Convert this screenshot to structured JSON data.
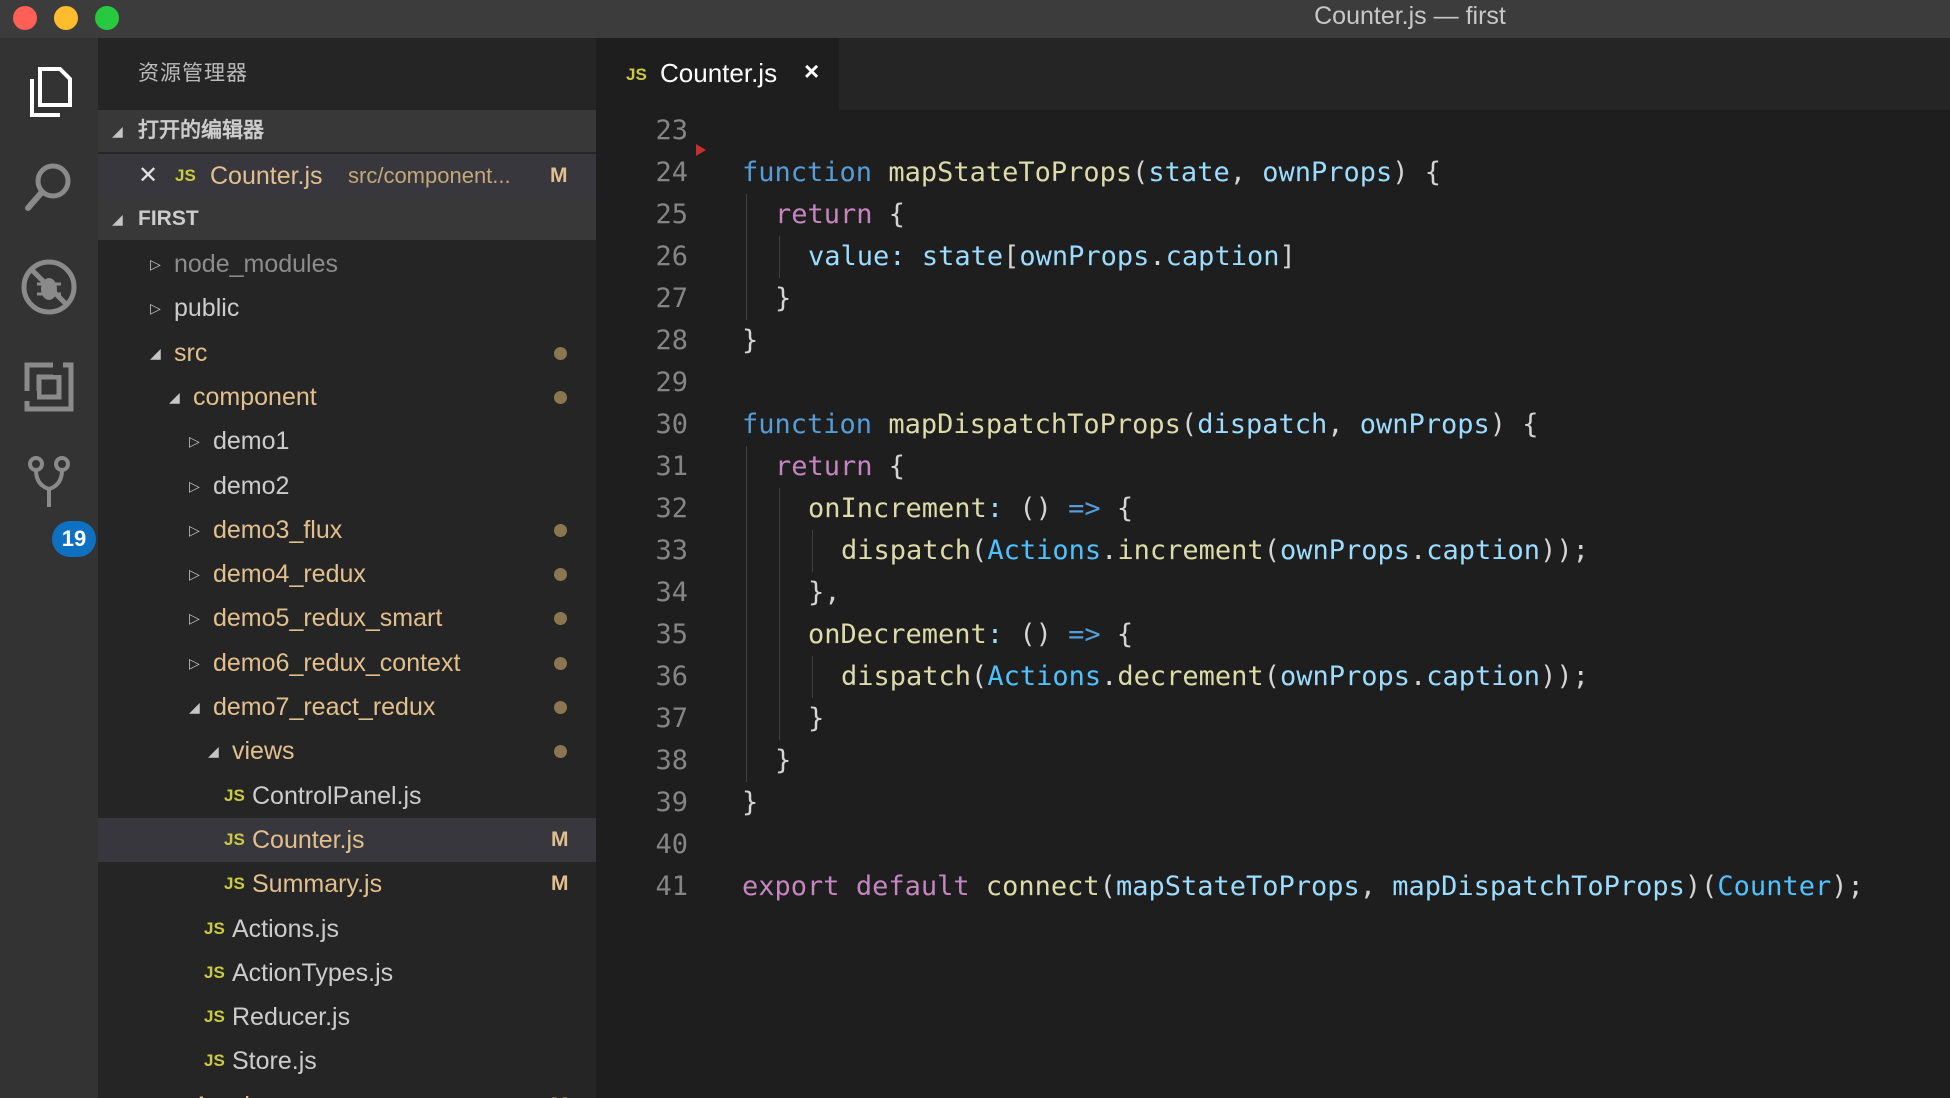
{
  "window": {
    "title": "Counter.js — first"
  },
  "activity_bar": {
    "items": [
      {
        "name": "explorer-icon"
      },
      {
        "name": "search-icon"
      },
      {
        "name": "debug-icon"
      },
      {
        "name": "extensions-icon"
      },
      {
        "name": "source-control-icon"
      }
    ],
    "scm_badge": "19"
  },
  "sidebar": {
    "title": "资源管理器",
    "open_editors": {
      "header": "打开的编辑器",
      "items": [
        {
          "icon": "JS",
          "name": "Counter.js",
          "path": "src/component...",
          "status": "M"
        }
      ]
    },
    "folder": {
      "header": "FIRST",
      "rows": [
        {
          "label": "node_modules",
          "type": "folder",
          "expanded": false,
          "depth": 1,
          "style": "ignored"
        },
        {
          "label": "public",
          "type": "folder",
          "expanded": false,
          "depth": 1,
          "style": "normal"
        },
        {
          "label": "src",
          "type": "folder",
          "expanded": true,
          "depth": 1,
          "style": "modified",
          "dot": true
        },
        {
          "label": "component",
          "type": "folder",
          "expanded": true,
          "depth": 2,
          "style": "modified",
          "dot": true
        },
        {
          "label": "demo1",
          "type": "folder",
          "expanded": false,
          "depth": 3,
          "style": "normal"
        },
        {
          "label": "demo2",
          "type": "folder",
          "expanded": false,
          "depth": 3,
          "style": "normal"
        },
        {
          "label": "demo3_flux",
          "type": "folder",
          "expanded": false,
          "depth": 3,
          "style": "modified",
          "dot": true
        },
        {
          "label": "demo4_redux",
          "type": "folder",
          "expanded": false,
          "depth": 3,
          "style": "modified",
          "dot": true
        },
        {
          "label": "demo5_redux_smart",
          "type": "folder",
          "expanded": false,
          "depth": 3,
          "style": "modified",
          "dot": true
        },
        {
          "label": "demo6_redux_context",
          "type": "folder",
          "expanded": false,
          "depth": 3,
          "style": "modified",
          "dot": true
        },
        {
          "label": "demo7_react_redux",
          "type": "folder",
          "expanded": true,
          "depth": 3,
          "style": "modified",
          "dot": true
        },
        {
          "label": "views",
          "type": "folder",
          "expanded": true,
          "depth": 4,
          "style": "modified",
          "dot": true
        },
        {
          "label": "ControlPanel.js",
          "type": "file",
          "depth": 5,
          "style": "normal",
          "icon": "JS"
        },
        {
          "label": "Counter.js",
          "type": "file",
          "depth": 5,
          "style": "modified",
          "icon": "JS",
          "status": "M",
          "selected": true
        },
        {
          "label": "Summary.js",
          "type": "file",
          "depth": 5,
          "style": "modified",
          "icon": "JS",
          "status": "M"
        },
        {
          "label": "Actions.js",
          "type": "file",
          "depth": 4,
          "style": "normal",
          "icon": "JS"
        },
        {
          "label": "ActionTypes.js",
          "type": "file",
          "depth": 4,
          "style": "normal",
          "icon": "JS"
        },
        {
          "label": "Reducer.js",
          "type": "file",
          "depth": 4,
          "style": "normal",
          "icon": "JS"
        },
        {
          "label": "Store.js",
          "type": "file",
          "depth": 4,
          "style": "normal",
          "icon": "JS"
        },
        {
          "label": "App.js",
          "type": "file",
          "depth": 2,
          "style": "modified",
          "icon": "JS",
          "status": "M"
        }
      ]
    }
  },
  "editor": {
    "tab": {
      "icon": "JS",
      "name": "Counter.js",
      "close": "×"
    },
    "lines": [
      {
        "n": "23",
        "indent": 0,
        "tokens": []
      },
      {
        "n": "24",
        "indent": 0,
        "tokens": [
          [
            "kw",
            "function"
          ],
          [
            "",
            " "
          ],
          [
            "fn",
            "mapStateToProps"
          ],
          [
            "",
            "("
          ],
          [
            "param",
            "state"
          ],
          [
            "",
            ", "
          ],
          [
            "param",
            "ownProps"
          ],
          [
            "",
            ") {"
          ]
        ]
      },
      {
        "n": "25",
        "indent": 1,
        "tokens": [
          [
            "ctl",
            "return"
          ],
          [
            "",
            ""
          ],
          [
            "",
            ""
          ],
          [
            "",
            " {"
          ]
        ]
      },
      {
        "n": "26",
        "indent": 2,
        "tokens": [
          [
            "prop",
            "value"
          ],
          [
            "prop",
            ":"
          ],
          [
            "",
            " "
          ],
          [
            "param",
            "state"
          ],
          [
            "",
            "["
          ],
          [
            "param",
            "ownProps"
          ],
          [
            "",
            "."
          ],
          [
            "prop",
            "caption"
          ],
          [
            "",
            "]"
          ]
        ]
      },
      {
        "n": "27",
        "indent": 1,
        "tokens": [
          [
            "",
            "}"
          ]
        ]
      },
      {
        "n": "28",
        "indent": 0,
        "tokens": [
          [
            "",
            "}"
          ]
        ]
      },
      {
        "n": "29",
        "indent": 0,
        "tokens": []
      },
      {
        "n": "30",
        "indent": 0,
        "tokens": [
          [
            "kw",
            "function"
          ],
          [
            "",
            " "
          ],
          [
            "fn",
            "mapDispatchToProps"
          ],
          [
            "",
            "("
          ],
          [
            "param",
            "dispatch"
          ],
          [
            "",
            ", "
          ],
          [
            "param",
            "ownProps"
          ],
          [
            "",
            ") {"
          ]
        ]
      },
      {
        "n": "31",
        "indent": 1,
        "tokens": [
          [
            "ctl",
            "return"
          ],
          [
            "",
            " {"
          ]
        ]
      },
      {
        "n": "32",
        "indent": 2,
        "tokens": [
          [
            "fn",
            "onIncrement"
          ],
          [
            "prop",
            ":"
          ],
          [
            "",
            " () "
          ],
          [
            "kw",
            "=>"
          ],
          [
            "",
            " {"
          ]
        ]
      },
      {
        "n": "33",
        "indent": 3,
        "tokens": [
          [
            "fn",
            "dispatch"
          ],
          [
            "",
            "("
          ],
          [
            "cls2",
            "Actions"
          ],
          [
            "",
            "."
          ],
          [
            "fn",
            "increment"
          ],
          [
            "",
            "("
          ],
          [
            "param",
            "ownProps"
          ],
          [
            "",
            "."
          ],
          [
            "prop",
            "caption"
          ],
          [
            "",
            "));"
          ]
        ]
      },
      {
        "n": "34",
        "indent": 2,
        "tokens": [
          [
            "",
            "},"
          ]
        ]
      },
      {
        "n": "35",
        "indent": 2,
        "tokens": [
          [
            "fn",
            "onDecrement"
          ],
          [
            "prop",
            ":"
          ],
          [
            "",
            " () "
          ],
          [
            "kw",
            "=>"
          ],
          [
            "",
            " {"
          ]
        ]
      },
      {
        "n": "36",
        "indent": 3,
        "tokens": [
          [
            "fn",
            "dispatch"
          ],
          [
            "",
            "("
          ],
          [
            "cls2",
            "Actions"
          ],
          [
            "",
            "."
          ],
          [
            "fn",
            "decrement"
          ],
          [
            "",
            "("
          ],
          [
            "param",
            "ownProps"
          ],
          [
            "",
            "."
          ],
          [
            "prop",
            "caption"
          ],
          [
            "",
            "));"
          ]
        ]
      },
      {
        "n": "37",
        "indent": 2,
        "tokens": [
          [
            "",
            "}"
          ]
        ]
      },
      {
        "n": "38",
        "indent": 1,
        "tokens": [
          [
            "",
            "}"
          ]
        ]
      },
      {
        "n": "39",
        "indent": 0,
        "tokens": [
          [
            "",
            "}"
          ]
        ]
      },
      {
        "n": "40",
        "indent": 0,
        "tokens": []
      },
      {
        "n": "41",
        "indent": 0,
        "tokens": [
          [
            "ctl",
            "export"
          ],
          [
            "",
            " "
          ],
          [
            "ctl",
            "default"
          ],
          [
            "",
            " "
          ],
          [
            "fn",
            "connect"
          ],
          [
            "",
            "("
          ],
          [
            "param",
            "mapStateToProps"
          ],
          [
            "",
            ", "
          ],
          [
            "param",
            "mapDispatchToProps"
          ],
          [
            "",
            ")("
          ],
          [
            "cls2",
            "Counter"
          ],
          [
            "",
            ");"
          ]
        ]
      }
    ]
  }
}
